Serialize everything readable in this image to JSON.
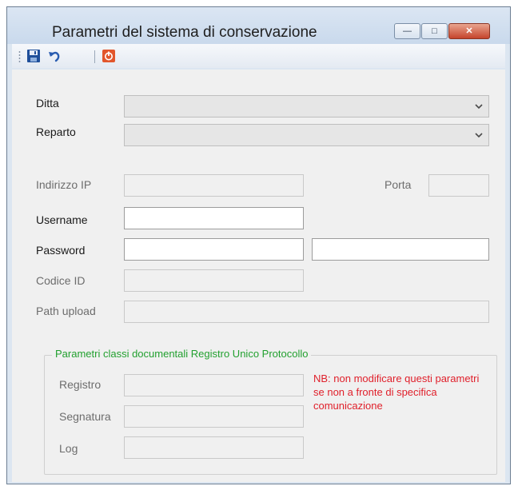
{
  "window": {
    "title": "Parametri del sistema di conservazione",
    "controls": {
      "minimize": "",
      "maximize": "",
      "close": ""
    }
  },
  "toolbar": {
    "buttons": [
      {
        "name": "save",
        "icon": "floppy-disk-icon"
      },
      {
        "name": "undo",
        "icon": "undo-arrow-icon"
      },
      {
        "name": "exit",
        "icon": "power-icon"
      }
    ]
  },
  "form": {
    "ditta": {
      "label": "Ditta",
      "value": ""
    },
    "reparto": {
      "label": "Reparto",
      "value": ""
    },
    "ip": {
      "label": "Indirizzo IP",
      "value": ""
    },
    "porta": {
      "label": "Porta",
      "value": ""
    },
    "username": {
      "label": "Username",
      "value": ""
    },
    "password": {
      "label": "Password",
      "value": "",
      "confirm_value": ""
    },
    "codice_id": {
      "label": "Codice ID",
      "value": ""
    },
    "path_upload": {
      "label": "Path upload",
      "value": ""
    }
  },
  "group": {
    "title": "Parametri classi documentali Registro Unico Protocollo",
    "registro": {
      "label": "Registro",
      "value": ""
    },
    "segnatura": {
      "label": "Segnatura",
      "value": ""
    },
    "log": {
      "label": "Log",
      "value": ""
    },
    "note": "NB: non modificare questi parametri se non a fronte di specifica comunicazione"
  },
  "colors": {
    "group_title": "#22a02f",
    "note": "#e0202b",
    "titlebar": "#c9d9ec"
  }
}
